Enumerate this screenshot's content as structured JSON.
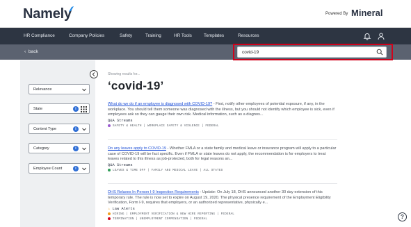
{
  "header": {
    "logo_text": "Namely",
    "powered_by": "Powered By",
    "partner_name": "Mineral"
  },
  "nav": {
    "items": [
      {
        "label": "HR Compliance"
      },
      {
        "label": "Company Policies"
      },
      {
        "label": "Safety"
      },
      {
        "label": "Training"
      },
      {
        "label": "HR Tools"
      },
      {
        "label": "Templates"
      },
      {
        "label": "Resources"
      }
    ],
    "icons": [
      "bell-icon",
      "user-icon"
    ]
  },
  "subbar": {
    "back_label": "back",
    "search_value": "covid-19"
  },
  "filters": [
    {
      "label": "Relevance",
      "info": false,
      "grid": false
    },
    {
      "label": "State",
      "info": true,
      "grid": true
    },
    {
      "label": "Content Type",
      "info": true,
      "grid": false
    },
    {
      "label": "Category",
      "info": true,
      "grid": false
    },
    {
      "label": "Employee Count",
      "info": true,
      "grid": false
    }
  ],
  "results_header": {
    "showing": "Showing results for...",
    "query": "‘covid-19’"
  },
  "results": [
    {
      "title": "What do we do if an employee is diagnosed with COVID-19?",
      "body": " - First, notify other employees of potential exposure, if any, in the workplace. You should tell them someone was diagnosed with the illness, but you should not identify which employee is sick, even if employees ask so they can gauge their own risk. Medical information, such as a diagnos...",
      "source": "Q&A Streams",
      "tags": "SAFETY & HEALTH | WORKPLACE SAFETY & VIOLENCE | FEDERAL",
      "tag_color": "#9b59d0"
    },
    {
      "title": "Do any leaves apply to COVID-19",
      "body": " - Whether FMLA or a state family and medical leave or insurance program will apply to a particular case of COVID-19 will be fact specific. Even if FMLA or state leaves do not apply, the recommendation is for employers to treat leaves related to this illness as job-protected, both for legal reasons an...",
      "source": "Q&A Streams",
      "tags": "LEAVES & TIME OFF | FAMILY AND MEDICAL LEAVE | ALL STATES",
      "tag_color": "#2e9d57"
    },
    {
      "title": "DHS Relaxes In-Person I-9 Inspection Requirements",
      "body": " - Update: On July 18, DHS announced another 30 day extension of this temporary rule. The rule is now set to expire on August 19, 2020. The physical presence requirement of the Employment Eligibility Verification, Form I-9, requires that employers, or an authorized representative, physically e...",
      "source": "Law Alerts",
      "tags": "HIRING | EMPLOYMENT VERIFICATION & NEW HIRE REPORTING | FEDERAL",
      "tags2": "TERMINATION | UNEMPLOYMENT COMPENSATION | FEDERAL",
      "tag_color": "#f0a020"
    }
  ],
  "help": {
    "label": "?"
  },
  "colors": {
    "nav_bg": "#2d3542",
    "subbar_bg": "#5b6270",
    "search_highlight": "#d0021b",
    "link": "#1d4fd7",
    "info_dot": "#2f6fd6"
  }
}
